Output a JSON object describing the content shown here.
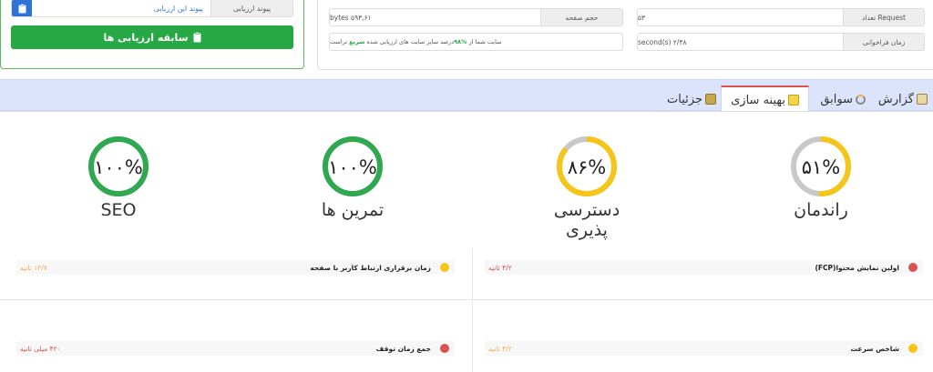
{
  "report_link": {
    "label": "پیوند ارزیابی",
    "value": "پیوند این ارزیابی"
  },
  "history_button": {
    "label": "سابقه ارزیابی ها"
  },
  "stats": {
    "request_count": {
      "label": "تعداد Request",
      "value": "۵۳"
    },
    "page_size": {
      "label": "حجم صفحه",
      "value": "bytes ۵۹۳,۶۱"
    },
    "load_time": {
      "label": "زمان فراخوانی",
      "value": "second(s) ۲/۴۸"
    },
    "comparison": {
      "prefix": "سایت شما از",
      "percent": "۹۸%",
      "middle": "درصد سایر سایت های ارزیابی شده",
      "speed": "سریع",
      "suffix": "تراست"
    }
  },
  "tabs": [
    {
      "label": "گزارش",
      "icon": "report-icon"
    },
    {
      "label": "سوابق",
      "icon": "history-icon"
    },
    {
      "label": "بهینه سازی",
      "icon": "optimize-icon",
      "active": true
    },
    {
      "label": "جزئیات",
      "icon": "details-icon"
    }
  ],
  "gauges": {
    "performance": {
      "score_text": "۵۱%",
      "title": "راندمان",
      "value": 51,
      "color": "#f5c518"
    },
    "accessibility": {
      "score_text": "۸۶%",
      "title": "دسترسی پذیری",
      "value": 86,
      "color": "#f5c518"
    },
    "best_practices": {
      "score_text": "۱۰۰%",
      "title": "تمرین ها",
      "value": 100,
      "color": "#2fa84f"
    },
    "seo": {
      "score_text": "۱۰۰%",
      "title": "SEO",
      "value": 100,
      "color": "#2fa84f"
    }
  },
  "metrics": {
    "fcp": {
      "label": "اولین نمایش محتوا(FCP)",
      "value": "۴/۲ ثانیه",
      "status": "red"
    },
    "tti": {
      "label": "زمان برقراری ارتباط کاربر با صفحه",
      "value": "۱۲/۷ ثانیه",
      "status": "orange"
    },
    "speed_index": {
      "label": "شاخص سرعت",
      "value": "۴/۲ ثانیه",
      "status": "orange"
    },
    "tbt": {
      "label": "جمع زمان توقف",
      "value": "۴۲۰ میلی ثانیه",
      "status": "red"
    }
  },
  "colors": {
    "green": "#28a745",
    "blue": "#2d73d6",
    "red": "#d9534f",
    "orange": "#f0ad4e",
    "yellow": "#f5c518",
    "track": "#c8c8c8"
  }
}
